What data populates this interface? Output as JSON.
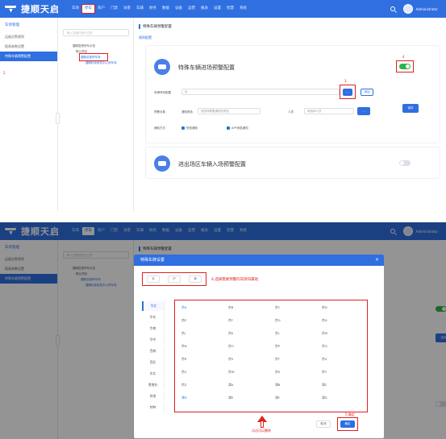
{
  "brand": {
    "name": "捷顺天启"
  },
  "topnav": {
    "items": [
      "车场",
      "停车",
      "商户",
      "门禁",
      "访客",
      "车辆",
      "财务",
      "数据",
      "设备",
      "运营",
      "报表",
      "设置",
      "智慧",
      "系统"
    ]
  },
  "user": {
    "name": "Administrator"
  },
  "sidebar": {
    "title": "车场管理",
    "items": [
      "运维告警规则",
      "报表参数设置",
      "特殊车辆预警配置"
    ],
    "mark": "2"
  },
  "tree": {
    "search_placeholder": "输入关键词进行过滤",
    "nodes": [
      "捷顺智慧停车示范",
      "默认项目",
      "捷顺总部停车场",
      "捷顺科技研发中心停车场"
    ]
  },
  "main": {
    "crumb": "特殊车辆预警配置",
    "subtab": "规则配置",
    "card1": {
      "title": "特殊车辆进场预警配置",
      "plate_label": "车牌号码配置",
      "plate_value": "京",
      "set_btn": "…",
      "add_btn": "添加",
      "notify_label": "预警对象",
      "role_label": "通知角色",
      "role_value": "请选择需要通知的角色",
      "person_label": "人员",
      "person_value": "请选择人员",
      "add_person_btn": "…",
      "save_btn": "保存",
      "method_label": "通知方式",
      "method1": "短信通知",
      "method2": "APP消息通知"
    },
    "card2": {
      "title": "进出场区车辆入场预警配置"
    },
    "marks": {
      "toggle": "4",
      "setbtn": "3"
    }
  },
  "modal": {
    "title": "特殊车牌设置",
    "close": "×",
    "chips": [
      "京",
      "沪",
      "津"
    ],
    "hint": "4.选择需要预警的车牌归属地",
    "tabs": [
      "华北",
      "华东",
      "华南",
      "华中",
      "西南",
      "西北",
      "东北",
      "港澳台",
      "其他",
      "特种"
    ],
    "cells": [
      "京A",
      "京B",
      "京C",
      "京D",
      "京E",
      "京F",
      "京G",
      "京H",
      "京J",
      "京K",
      "京L",
      "京M",
      "京N",
      "京O",
      "京P",
      "京Q",
      "京R",
      "京S",
      "京T",
      "京U",
      "京V",
      "京W",
      "京X",
      "京Y",
      "京Z",
      "津A",
      "津B",
      "津C",
      "津D",
      "津E",
      "津F",
      "津G"
    ],
    "bottom_hint": "点击可以删除",
    "confirm_mark": "5.确定",
    "cancel_btn": "取消",
    "confirm_btn": "确定"
  }
}
